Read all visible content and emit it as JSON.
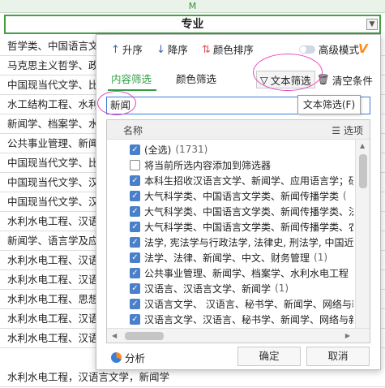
{
  "sheet": {
    "column_letter": "M",
    "header": "专业",
    "rows": [
      "哲学类、中国语言文学类",
      "马克思主义哲学、政治学",
      "中国现当代文学、比较文学",
      "水工结构工程、水利水电工程",
      "新闻学、档案学、水利水电工程",
      "公共事业管理、新闻学",
      "中国现当代文学、比较文学",
      "中国现当代文学、汉语言文学",
      "中国现当代文学、汉语言文学",
      "水利水电工程、汉语言文学",
      "新闻学、语言学及应用语言学",
      "水利水电工程、汉语言文学",
      "水利水电工程、汉语言文学",
      "水利水电工程、思想政治教育",
      "水利水电工程、汉语言文学",
      "水利水电工程、汉语言文学",
      "水利水电工程，汉语言文学，新闻学"
    ]
  },
  "filter_panel": {
    "toolbar": {
      "sort_asc": "升序",
      "sort_desc": "降序",
      "color_sort": "颜色排序",
      "advanced_mode": "高级模式",
      "vip_badge": "V"
    },
    "tabs": {
      "content_filter": "内容筛选",
      "color_filter": "颜色筛选"
    },
    "text_filter_button": "文本筛选",
    "clear_button": "清空条件",
    "search_value": "新闻",
    "tooltip": "文本筛选(F)",
    "list_header": {
      "name": "名称",
      "options": "选项"
    },
    "items": [
      {
        "label": "(全选)",
        "count": "(1731)",
        "checked": true
      },
      {
        "label": "将当前所选内容添加到筛选器",
        "count": "",
        "checked": false
      },
      {
        "label": "本科生招收汉语言文学、新闻学、应用语言学；研",
        "count": "",
        "checked": true
      },
      {
        "label": "大气科学类、中国语言文学类、新闻传播学类",
        "count": "(",
        "checked": true
      },
      {
        "label": "大气科学类、中国语言文学类、新闻传播学类、法",
        "count": "",
        "checked": true
      },
      {
        "label": "大气科学类、中国语言文学类、新闻传播学类、农",
        "count": "",
        "checked": true
      },
      {
        "label": "法学, 宪法学与行政法学, 法律史, 刑法学, 中国近现",
        "count": "",
        "checked": true
      },
      {
        "label": "法学、法律、新闻学、中文、财务管理",
        "count": "(1)",
        "checked": true
      },
      {
        "label": "公共事业管理、新闻学、档案学、水利水电工程",
        "count": "",
        "checked": true
      },
      {
        "label": "汉语言、汉语言文学、新闻学",
        "count": "(1)",
        "checked": true
      },
      {
        "label": "汉语言文学、 汉语言、秘书学、新闻学、网络与新",
        "count": "",
        "checked": true
      },
      {
        "label": "汉语言文学、汉语言、秘书学、新闻学、网络与新",
        "count": "",
        "checked": true
      }
    ],
    "footer": {
      "analyze": "分析",
      "ok": "确定",
      "cancel": "取消"
    },
    "colors": {
      "accent_green": "#2f9e44",
      "checkbox_blue": "#4a7fc9",
      "annotation_pink": "#e64bc5",
      "vip_orange": "#ff8c1a"
    }
  }
}
